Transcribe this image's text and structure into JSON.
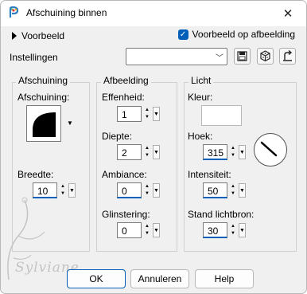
{
  "window": {
    "title": "Afschuining binnen",
    "close_glyph": "✕"
  },
  "preview": {
    "label": "Voorbeeld",
    "checkbox_label": "Voorbeeld op afbeelding",
    "checked": true
  },
  "settings": {
    "label": "Instellingen",
    "value": ""
  },
  "groups": {
    "bevel": {
      "title": "Afschuining",
      "shape_label": "Afschuining:",
      "width_label": "Breedte:",
      "width_value": "10"
    },
    "image": {
      "title": "Afbeelding",
      "smoothness_label": "Effenheid:",
      "smoothness_value": "1",
      "depth_label": "Diepte:",
      "depth_value": "2",
      "ambience_label": "Ambiance:",
      "ambience_value": "0",
      "shininess_label": "Glinstering:",
      "shininess_value": "0"
    },
    "light": {
      "title": "Licht",
      "color_label": "Kleur:",
      "color_value": "#ffffff",
      "angle_label": "Hoek:",
      "angle_value": "315",
      "intensity_label": "Intensiteit:",
      "intensity_value": "50",
      "elevation_label": "Stand lichtbron:",
      "elevation_value": "30"
    }
  },
  "buttons": {
    "ok": "OK",
    "cancel": "Annuleren",
    "help": "Help"
  },
  "watermark": "Sylviane",
  "colors": {
    "accent": "#005fb8",
    "bg": "#f0f0f0"
  }
}
